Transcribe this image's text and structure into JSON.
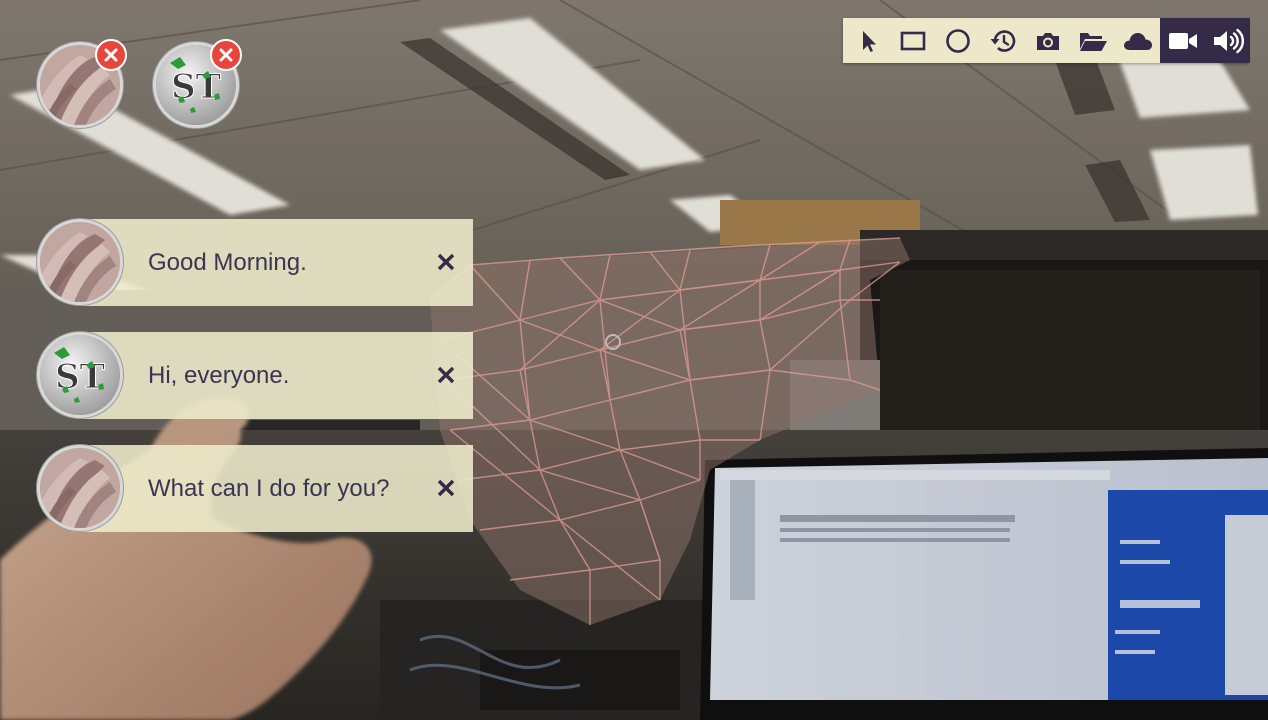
{
  "toolbar": {
    "tools": [
      {
        "icon": "pointer-icon",
        "active": false
      },
      {
        "icon": "rectangle-icon",
        "active": false
      },
      {
        "icon": "circle-icon",
        "active": false
      },
      {
        "icon": "history-icon",
        "active": false
      },
      {
        "icon": "camera-icon",
        "active": false
      },
      {
        "icon": "folder-open-icon",
        "active": false
      },
      {
        "icon": "cloud-icon",
        "active": false
      },
      {
        "icon": "video-camera-icon",
        "active": true
      },
      {
        "icon": "volume-icon",
        "active": true
      }
    ],
    "colors": {
      "light_bg": "#ece8c9",
      "dark_bg": "#332b48",
      "icon_dark": "#332b48",
      "icon_light": "#ffffff"
    }
  },
  "participants": [
    {
      "avatar": "user-photo-avatar",
      "remove_icon": "close-icon"
    },
    {
      "avatar": "st-logo-avatar",
      "remove_icon": "close-icon"
    }
  ],
  "messages": [
    {
      "avatar": "user-photo-avatar",
      "text": "Good Morning.",
      "close_icon": "close-icon"
    },
    {
      "avatar": "st-logo-avatar",
      "text": "Hi, everyone.",
      "close_icon": "close-icon"
    },
    {
      "avatar": "user-photo-avatar",
      "text": "What can I do for you?",
      "close_icon": "close-icon"
    }
  ],
  "colors": {
    "bubble_bg": "#eeeccc",
    "message_text": "#3a3552",
    "remove_red": "#e8453c",
    "mesh_color": "#f0a8a0"
  }
}
